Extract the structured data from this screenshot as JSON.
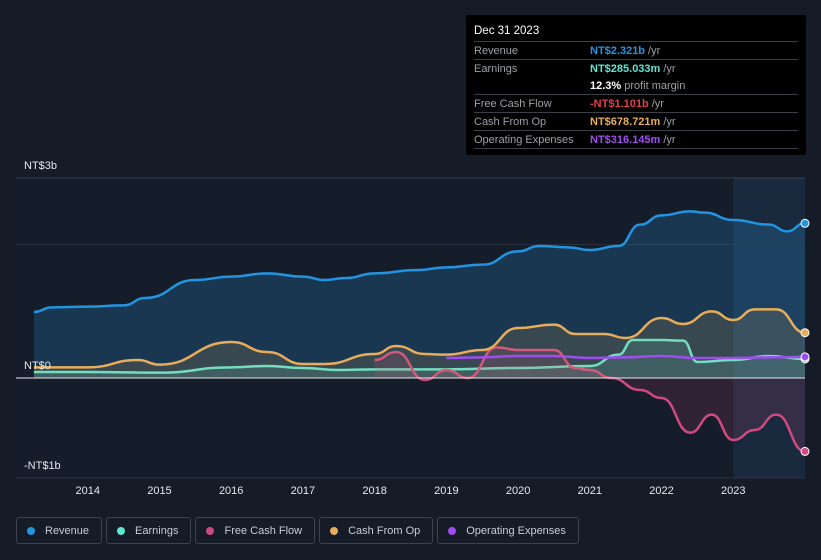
{
  "tooltip": {
    "date": "Dec 31 2023",
    "rows": [
      {
        "label": "Revenue",
        "value": "NT$2.321b",
        "unit": "/yr",
        "color": "#2394e0"
      },
      {
        "label": "Earnings",
        "value": "NT$285.033m",
        "unit": "/yr",
        "color": "#5ee6d0"
      },
      {
        "label": "",
        "value": "12.3%",
        "unit": "profit margin",
        "color": "#ffffff"
      },
      {
        "label": "Free Cash Flow",
        "value": "-NT$1.101b",
        "unit": "/yr",
        "color": "#e0404a"
      },
      {
        "label": "Cash From Op",
        "value": "NT$678.721m",
        "unit": "/yr",
        "color": "#e8ad5a"
      },
      {
        "label": "Operating Expenses",
        "value": "NT$316.145m",
        "unit": "/yr",
        "color": "#a04df0"
      }
    ]
  },
  "chart_data": {
    "type": "line",
    "yaxis": {
      "ticks": [
        {
          "value": 3,
          "label": "NT$3b"
        },
        {
          "value": 0,
          "label": "NT$0"
        },
        {
          "value": -1,
          "label": "-NT$1b"
        }
      ],
      "range": [
        -1.5,
        3
      ],
      "unit": "NT$ billions"
    },
    "xaxis": {
      "ticks": [
        "2014",
        "2015",
        "2016",
        "2017",
        "2018",
        "2019",
        "2020",
        "2021",
        "2022",
        "2023"
      ],
      "range": [
        2013,
        2024
      ]
    },
    "highlight_from": 2023,
    "series": [
      {
        "name": "Revenue",
        "color": "#2394e0",
        "fill": true,
        "x": [
          2013.25,
          2013.5,
          2014,
          2014.5,
          2014.8,
          2015.5,
          2016,
          2016.5,
          2017,
          2017.3,
          2017.6,
          2018,
          2018.6,
          2019,
          2019.5,
          2020,
          2020.3,
          2020.7,
          2021,
          2021.4,
          2021.7,
          2022,
          2022.4,
          2022.6,
          2023,
          2023.5,
          2023.75,
          2024
        ],
        "y": [
          0.99,
          1.06,
          1.07,
          1.09,
          1.2,
          1.47,
          1.52,
          1.57,
          1.52,
          1.47,
          1.5,
          1.57,
          1.62,
          1.66,
          1.7,
          1.9,
          1.98,
          1.96,
          1.92,
          1.98,
          2.3,
          2.44,
          2.5,
          2.48,
          2.37,
          2.3,
          2.2,
          2.321
        ]
      },
      {
        "name": "Earnings",
        "color": "#5ee6d0",
        "fill": true,
        "x": [
          2013.25,
          2014,
          2015,
          2016,
          2016.5,
          2017,
          2017.5,
          2018,
          2019,
          2020,
          2021,
          2021.4,
          2021.6,
          2022,
          2022.3,
          2022.5,
          2023,
          2023.5,
          2024
        ],
        "y": [
          0.09,
          0.09,
          0.08,
          0.16,
          0.18,
          0.15,
          0.12,
          0.13,
          0.13,
          0.15,
          0.18,
          0.35,
          0.57,
          0.57,
          0.56,
          0.24,
          0.27,
          0.33,
          0.285
        ]
      },
      {
        "name": "Free Cash Flow",
        "color": "#d04a82",
        "fill": true,
        "x": [
          2018,
          2018.3,
          2018.7,
          2019,
          2019.3,
          2019.7,
          2020,
          2020.5,
          2020.8,
          2021,
          2021.3,
          2021.7,
          2022,
          2022.4,
          2022.7,
          2023,
          2023.3,
          2023.6,
          2024
        ],
        "y": [
          0.27,
          0.39,
          -0.03,
          0.12,
          0.0,
          0.46,
          0.42,
          0.42,
          0.15,
          0.12,
          0.0,
          -0.18,
          -0.3,
          -0.82,
          -0.55,
          -0.93,
          -0.78,
          -0.55,
          -1.101
        ]
      },
      {
        "name": "Cash From Op",
        "color": "#e8ad5a",
        "fill": true,
        "x": [
          2013.25,
          2014,
          2014.7,
          2015,
          2016,
          2016.5,
          2017,
          2017.3,
          2018,
          2018.3,
          2018.7,
          2019,
          2019.5,
          2020,
          2020.5,
          2020.8,
          2021.2,
          2021.5,
          2022,
          2022.3,
          2022.7,
          2023,
          2023.3,
          2023.6,
          2024
        ],
        "y": [
          0.16,
          0.16,
          0.27,
          0.2,
          0.54,
          0.39,
          0.21,
          0.21,
          0.36,
          0.48,
          0.36,
          0.35,
          0.42,
          0.75,
          0.8,
          0.66,
          0.66,
          0.6,
          0.9,
          0.81,
          1.0,
          0.87,
          1.03,
          1.03,
          0.679
        ]
      },
      {
        "name": "Operating Expenses",
        "color": "#a04df0",
        "fill": false,
        "x": [
          2019,
          2019.5,
          2020,
          2020.5,
          2021,
          2021.5,
          2022,
          2022.5,
          2023,
          2023.5,
          2024
        ],
        "y": [
          0.3,
          0.31,
          0.33,
          0.33,
          0.3,
          0.31,
          0.33,
          0.3,
          0.3,
          0.31,
          0.316
        ]
      }
    ]
  },
  "legend": [
    {
      "label": "Revenue",
      "color": "#2394e0"
    },
    {
      "label": "Earnings",
      "color": "#5ee6d0"
    },
    {
      "label": "Free Cash Flow",
      "color": "#d04a82"
    },
    {
      "label": "Cash From Op",
      "color": "#e8ad5a"
    },
    {
      "label": "Operating Expenses",
      "color": "#a04df0"
    }
  ]
}
